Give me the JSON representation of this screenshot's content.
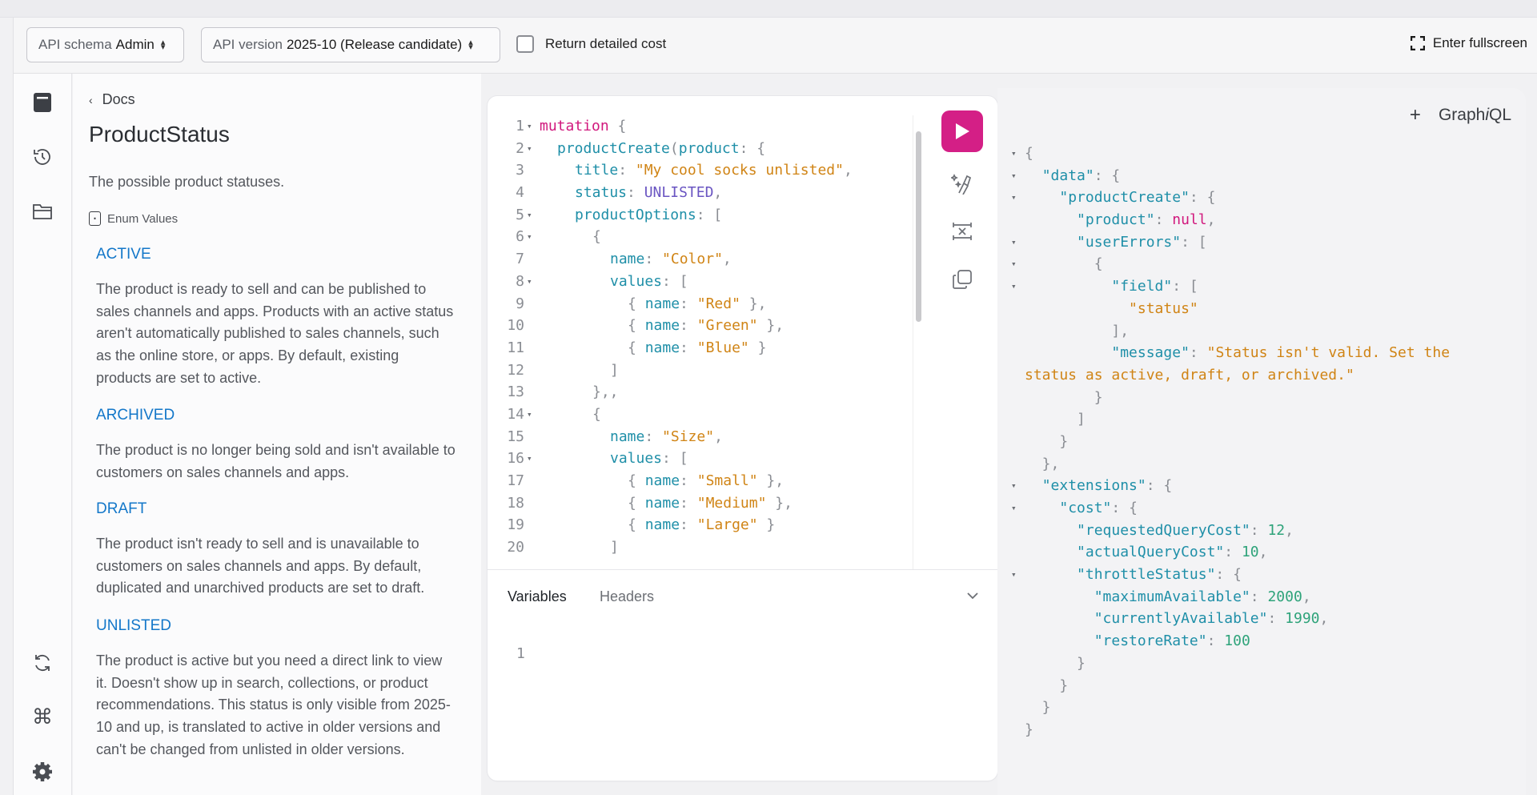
{
  "toolbar": {
    "schema_label": "API schema",
    "schema_value": "Admin",
    "version_label": "API version",
    "version_value": "2025-10 (Release candidate)",
    "detailed_cost_label": "Return detailed cost",
    "detailed_cost_checked": false,
    "fullscreen_label": "Enter fullscreen"
  },
  "sidebar_icons": [
    "docs-book-icon",
    "history-icon",
    "explorer-folder-icon",
    "refetch-schema-icon",
    "shortcuts-command-icon",
    "settings-gear-icon"
  ],
  "docs": {
    "back_label": "Docs",
    "title": "ProductStatus",
    "description": "The possible product statuses.",
    "enum_header": "Enum Values",
    "enum_values": [
      {
        "name": "ACTIVE",
        "description": "The product is ready to sell and can be published to sales channels and apps. Products with an active status aren't automatically published to sales channels, such as the online store, or apps. By default, existing products are set to active."
      },
      {
        "name": "ARCHIVED",
        "description": "The product is no longer being sold and isn't available to customers on sales channels and apps."
      },
      {
        "name": "DRAFT",
        "description": "The product isn't ready to sell and is unavailable to customers on sales channels and apps. By default, duplicated and unarchived products are set to draft."
      },
      {
        "name": "UNLISTED",
        "description": "The product is active but you need a direct link to view it. Doesn't show up in search, collections, or product recommendations. This status is only visible from 2025-10 and up, is translated to active in older versions and can't be changed from unlisted in older versions."
      }
    ]
  },
  "editor": {
    "lines": [
      {
        "n": "1",
        "fold": true,
        "indent": 0,
        "tokens": [
          [
            "kw",
            "mutation"
          ],
          [
            "pu",
            " {"
          ]
        ]
      },
      {
        "n": "2",
        "fold": true,
        "indent": 1,
        "tokens": [
          [
            "fn",
            "productCreate"
          ],
          [
            "pu",
            "("
          ],
          [
            "pr",
            "product"
          ],
          [
            "pu",
            ": {"
          ]
        ]
      },
      {
        "n": "3",
        "fold": false,
        "indent": 2,
        "tokens": [
          [
            "pr",
            "title"
          ],
          [
            "pu",
            ": "
          ],
          [
            "st",
            "\"My cool socks unlisted\""
          ],
          [
            "pu",
            ","
          ]
        ]
      },
      {
        "n": "4",
        "fold": false,
        "indent": 2,
        "tokens": [
          [
            "pr",
            "status"
          ],
          [
            "pu",
            ": "
          ],
          [
            "en",
            "UNLISTED"
          ],
          [
            "pu",
            ","
          ]
        ]
      },
      {
        "n": "5",
        "fold": true,
        "indent": 2,
        "tokens": [
          [
            "pr",
            "productOptions"
          ],
          [
            "pu",
            ": ["
          ]
        ]
      },
      {
        "n": "6",
        "fold": true,
        "indent": 3,
        "tokens": [
          [
            "pu",
            "{"
          ]
        ]
      },
      {
        "n": "7",
        "fold": false,
        "indent": 4,
        "tokens": [
          [
            "pr",
            "name"
          ],
          [
            "pu",
            ": "
          ],
          [
            "st",
            "\"Color\""
          ],
          [
            "pu",
            ","
          ]
        ]
      },
      {
        "n": "8",
        "fold": true,
        "indent": 4,
        "tokens": [
          [
            "pr",
            "values"
          ],
          [
            "pu",
            ": ["
          ]
        ]
      },
      {
        "n": "9",
        "fold": false,
        "indent": 5,
        "tokens": [
          [
            "pu",
            "{ "
          ],
          [
            "pr",
            "name"
          ],
          [
            "pu",
            ": "
          ],
          [
            "st",
            "\"Red\""
          ],
          [
            "pu",
            " },"
          ]
        ]
      },
      {
        "n": "10",
        "fold": false,
        "indent": 5,
        "tokens": [
          [
            "pu",
            "{ "
          ],
          [
            "pr",
            "name"
          ],
          [
            "pu",
            ": "
          ],
          [
            "st",
            "\"Green\""
          ],
          [
            "pu",
            " },"
          ]
        ]
      },
      {
        "n": "11",
        "fold": false,
        "indent": 5,
        "tokens": [
          [
            "pu",
            "{ "
          ],
          [
            "pr",
            "name"
          ],
          [
            "pu",
            ": "
          ],
          [
            "st",
            "\"Blue\""
          ],
          [
            "pu",
            " }"
          ]
        ]
      },
      {
        "n": "12",
        "fold": false,
        "indent": 4,
        "tokens": [
          [
            "pu",
            "]"
          ]
        ]
      },
      {
        "n": "13",
        "fold": false,
        "indent": 3,
        "tokens": [
          [
            "pu",
            "},,"
          ]
        ]
      },
      {
        "n": "14",
        "fold": true,
        "indent": 3,
        "tokens": [
          [
            "pu",
            "{"
          ]
        ]
      },
      {
        "n": "15",
        "fold": false,
        "indent": 4,
        "tokens": [
          [
            "pr",
            "name"
          ],
          [
            "pu",
            ": "
          ],
          [
            "st",
            "\"Size\""
          ],
          [
            "pu",
            ","
          ]
        ]
      },
      {
        "n": "16",
        "fold": true,
        "indent": 4,
        "tokens": [
          [
            "pr",
            "values"
          ],
          [
            "pu",
            ": ["
          ]
        ]
      },
      {
        "n": "17",
        "fold": false,
        "indent": 5,
        "tokens": [
          [
            "pu",
            "{ "
          ],
          [
            "pr",
            "name"
          ],
          [
            "pu",
            ": "
          ],
          [
            "st",
            "\"Small\""
          ],
          [
            "pu",
            " },"
          ]
        ]
      },
      {
        "n": "18",
        "fold": false,
        "indent": 5,
        "tokens": [
          [
            "pu",
            "{ "
          ],
          [
            "pr",
            "name"
          ],
          [
            "pu",
            ": "
          ],
          [
            "st",
            "\"Medium\""
          ],
          [
            "pu",
            " },"
          ]
        ]
      },
      {
        "n": "19",
        "fold": false,
        "indent": 5,
        "tokens": [
          [
            "pu",
            "{ "
          ],
          [
            "pr",
            "name"
          ],
          [
            "pu",
            ": "
          ],
          [
            "st",
            "\"Large\""
          ],
          [
            "pu",
            " }"
          ]
        ]
      },
      {
        "n": "20",
        "fold": false,
        "indent": 4,
        "tokens": [
          [
            "pu",
            "]"
          ]
        ]
      }
    ],
    "tabs": {
      "variables": "Variables",
      "headers": "Headers"
    },
    "variables_line": "1"
  },
  "result_panel": {
    "add_tab": "+",
    "brand_prefix": "Graph",
    "brand_italic": "i",
    "brand_suffix": "QL",
    "lines": [
      {
        "fold": true,
        "tokens": [
          [
            "jp",
            "{"
          ]
        ]
      },
      {
        "fold": true,
        "tokens": [
          [
            "jp",
            "  "
          ],
          [
            "jk",
            "\"data\""
          ],
          [
            "jp",
            ": {"
          ]
        ]
      },
      {
        "fold": true,
        "tokens": [
          [
            "jp",
            "    "
          ],
          [
            "jk",
            "\"productCreate\""
          ],
          [
            "jp",
            ": {"
          ]
        ]
      },
      {
        "fold": false,
        "tokens": [
          [
            "jp",
            "      "
          ],
          [
            "jk",
            "\"product\""
          ],
          [
            "jp",
            ": "
          ],
          [
            "jnull",
            "null"
          ],
          [
            "jp",
            ","
          ]
        ]
      },
      {
        "fold": true,
        "tokens": [
          [
            "jp",
            "      "
          ],
          [
            "jk",
            "\"userErrors\""
          ],
          [
            "jp",
            ": ["
          ]
        ]
      },
      {
        "fold": true,
        "tokens": [
          [
            "jp",
            "        {"
          ]
        ]
      },
      {
        "fold": true,
        "tokens": [
          [
            "jp",
            "          "
          ],
          [
            "jk",
            "\"field\""
          ],
          [
            "jp",
            ": ["
          ]
        ]
      },
      {
        "fold": false,
        "tokens": [
          [
            "jp",
            "            "
          ],
          [
            "js",
            "\"status\""
          ]
        ]
      },
      {
        "fold": false,
        "tokens": [
          [
            "jp",
            "          ],"
          ]
        ]
      },
      {
        "fold": false,
        "tokens": [
          [
            "jp",
            "          "
          ],
          [
            "jk",
            "\"message\""
          ],
          [
            "jp",
            ": "
          ],
          [
            "js",
            "\"Status isn't valid. Set the"
          ]
        ]
      },
      {
        "fold": false,
        "tokens": [
          [
            "js",
            "status as active, draft, or archived.\""
          ]
        ]
      },
      {
        "fold": false,
        "tokens": [
          [
            "jp",
            "        }"
          ]
        ]
      },
      {
        "fold": false,
        "tokens": [
          [
            "jp",
            "      ]"
          ]
        ]
      },
      {
        "fold": false,
        "tokens": [
          [
            "jp",
            "    }"
          ]
        ]
      },
      {
        "fold": false,
        "tokens": [
          [
            "jp",
            "  },"
          ]
        ]
      },
      {
        "fold": true,
        "tokens": [
          [
            "jp",
            "  "
          ],
          [
            "jk",
            "\"extensions\""
          ],
          [
            "jp",
            ": {"
          ]
        ]
      },
      {
        "fold": true,
        "tokens": [
          [
            "jp",
            "    "
          ],
          [
            "jk",
            "\"cost\""
          ],
          [
            "jp",
            ": {"
          ]
        ]
      },
      {
        "fold": false,
        "tokens": [
          [
            "jp",
            "      "
          ],
          [
            "jk",
            "\"requestedQueryCost\""
          ],
          [
            "jp",
            ": "
          ],
          [
            "jn",
            "12"
          ],
          [
            "jp",
            ","
          ]
        ]
      },
      {
        "fold": false,
        "tokens": [
          [
            "jp",
            "      "
          ],
          [
            "jk",
            "\"actualQueryCost\""
          ],
          [
            "jp",
            ": "
          ],
          [
            "jn",
            "10"
          ],
          [
            "jp",
            ","
          ]
        ]
      },
      {
        "fold": true,
        "tokens": [
          [
            "jp",
            "      "
          ],
          [
            "jk",
            "\"throttleStatus\""
          ],
          [
            "jp",
            ": {"
          ]
        ]
      },
      {
        "fold": false,
        "tokens": [
          [
            "jp",
            "        "
          ],
          [
            "jk",
            "\"maximumAvailable\""
          ],
          [
            "jp",
            ": "
          ],
          [
            "jn",
            "2000"
          ],
          [
            "jp",
            ","
          ]
        ]
      },
      {
        "fold": false,
        "tokens": [
          [
            "jp",
            "        "
          ],
          [
            "jk",
            "\"currentlyAvailable\""
          ],
          [
            "jp",
            ": "
          ],
          [
            "jn",
            "1990"
          ],
          [
            "jp",
            ","
          ]
        ]
      },
      {
        "fold": false,
        "tokens": [
          [
            "jp",
            "        "
          ],
          [
            "jk",
            "\"restoreRate\""
          ],
          [
            "jp",
            ": "
          ],
          [
            "jn",
            "100"
          ]
        ]
      },
      {
        "fold": false,
        "tokens": [
          [
            "jp",
            "      }"
          ]
        ]
      },
      {
        "fold": false,
        "tokens": [
          [
            "jp",
            "    }"
          ]
        ]
      },
      {
        "fold": false,
        "tokens": [
          [
            "jp",
            "  }"
          ]
        ]
      },
      {
        "fold": false,
        "tokens": [
          [
            "jp",
            "}"
          ]
        ]
      }
    ]
  },
  "colors": {
    "run_button": "#d41f86",
    "link_blue": "#1377c9",
    "keyword": "#d1187d",
    "string": "#d08415",
    "number": "#2ea37a",
    "property": "#1f8fa8"
  }
}
